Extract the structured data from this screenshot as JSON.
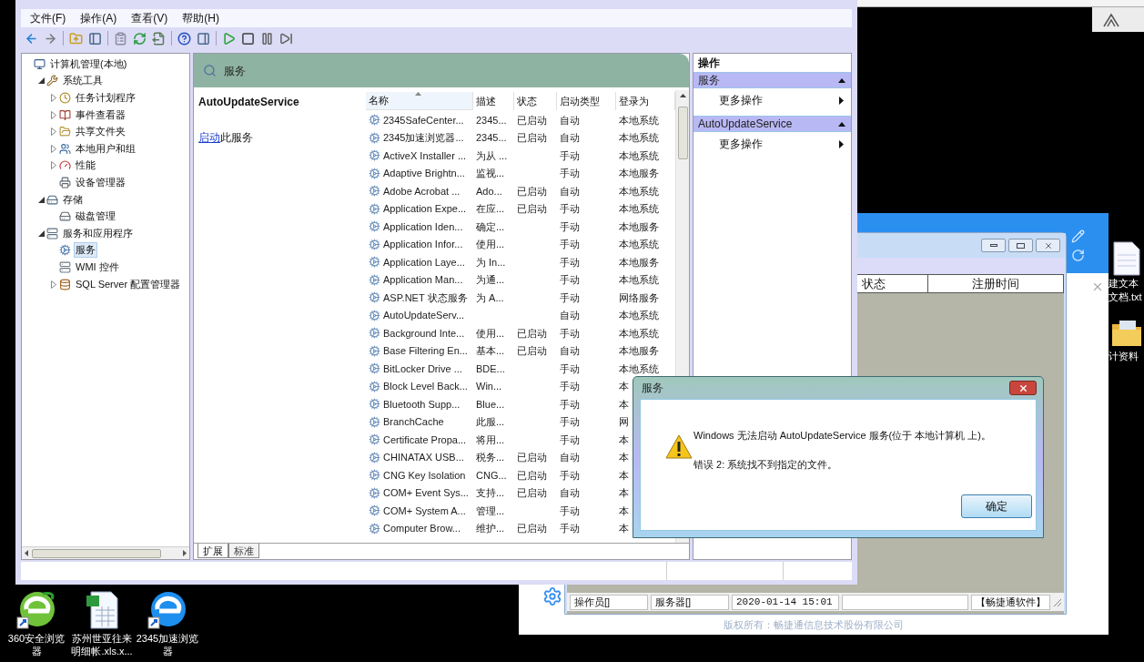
{
  "main_window": {
    "menu": [
      "文件(F)",
      "操作(A)",
      "查看(V)",
      "帮助(H)"
    ],
    "tree": [
      {
        "label": "计算机管理(本地)",
        "selected": false,
        "children": [
          {
            "label": "系统工具",
            "expanded": true,
            "selected": false,
            "children": [
              {
                "label": "任务计划程序",
                "expanded": false,
                "selected": false
              },
              {
                "label": "事件查看器",
                "expanded": false,
                "selected": false
              },
              {
                "label": "共享文件夹",
                "expanded": false,
                "selected": false
              },
              {
                "label": "本地用户和组",
                "expanded": false,
                "selected": false
              },
              {
                "label": "性能",
                "expanded": false,
                "selected": false
              },
              {
                "label": "设备管理器",
                "selected": false
              }
            ]
          },
          {
            "label": "存储",
            "expanded": true,
            "selected": false,
            "children": [
              {
                "label": "磁盘管理",
                "selected": false
              }
            ]
          },
          {
            "label": "服务和应用程序",
            "expanded": true,
            "selected": false,
            "children": [
              {
                "label": "服务",
                "selected": true
              },
              {
                "label": "WMI 控件",
                "selected": false
              },
              {
                "label": "SQL Server 配置管理器",
                "expanded": false,
                "selected": false
              }
            ]
          }
        ]
      }
    ],
    "section_header": "服务",
    "detail": {
      "title": "AutoUpdateService",
      "link": "启动",
      "text": "此服务"
    },
    "columns": [
      {
        "label": "名称",
        "sorted": true
      },
      {
        "label": "描述",
        "sorted": false
      },
      {
        "label": "状态",
        "sorted": false
      },
      {
        "label": "启动类型",
        "sorted": false
      },
      {
        "label": "登录为",
        "sorted": false
      }
    ],
    "rows": [
      {
        "name": "2345SafeCenter...",
        "description": "2345...",
        "status": "已启动",
        "startup": "自动",
        "logon": "本地系统"
      },
      {
        "name": "2345加速浏览器...",
        "description": "2345...",
        "status": "已启动",
        "startup": "自动",
        "logon": "本地系统"
      },
      {
        "name": "ActiveX Installer ...",
        "description": "为从 ...",
        "startup": "手动",
        "logon": "本地系统"
      },
      {
        "name": "Adaptive Brightn...",
        "description": "监视...",
        "startup": "手动",
        "logon": "本地服务"
      },
      {
        "name": "Adobe Acrobat ...",
        "description": "Ado...",
        "status": "已启动",
        "startup": "自动",
        "logon": "本地系统"
      },
      {
        "name": "Application Expe...",
        "description": "在应...",
        "status": "已启动",
        "startup": "手动",
        "logon": "本地系统"
      },
      {
        "name": "Application Iden...",
        "description": "确定...",
        "startup": "手动",
        "logon": "本地服务"
      },
      {
        "name": "Application Infor...",
        "description": "使用...",
        "startup": "手动",
        "logon": "本地系统"
      },
      {
        "name": "Application Laye...",
        "description": "为 In...",
        "startup": "手动",
        "logon": "本地服务"
      },
      {
        "name": "Application Man...",
        "description": "为通...",
        "startup": "手动",
        "logon": "本地系统"
      },
      {
        "name": "ASP.NET 状态服务",
        "description": "为 A...",
        "startup": "手动",
        "logon": "网络服务"
      },
      {
        "name": "AutoUpdateServ...",
        "startup": "自动",
        "logon": "本地系统"
      },
      {
        "name": "Background Inte...",
        "description": "使用...",
        "status": "已启动",
        "startup": "手动",
        "logon": "本地系统"
      },
      {
        "name": "Base Filtering En...",
        "description": "基本...",
        "status": "已启动",
        "startup": "自动",
        "logon": "本地服务"
      },
      {
        "name": "BitLocker Drive ...",
        "description": "BDE...",
        "startup": "手动",
        "logon": "本地系统"
      },
      {
        "name": "Block Level Back...",
        "description": "Win...",
        "startup": "手动",
        "logon": "本"
      },
      {
        "name": "Bluetooth Supp...",
        "description": "Blue...",
        "startup": "手动",
        "logon": "本"
      },
      {
        "name": "BranchCache",
        "description": "此服...",
        "startup": "手动",
        "logon": "网"
      },
      {
        "name": "Certificate Propa...",
        "description": "将用...",
        "startup": "手动",
        "logon": "本"
      },
      {
        "name": "CHINATAX USB...",
        "description": "税务...",
        "status": "已启动",
        "startup": "自动",
        "logon": "本"
      },
      {
        "name": "CNG Key Isolation",
        "description": "CNG...",
        "status": "已启动",
        "startup": "手动",
        "logon": "本"
      },
      {
        "name": "COM+ Event Sys...",
        "description": "支持...",
        "status": "已启动",
        "startup": "自动",
        "logon": "本"
      },
      {
        "name": "COM+ System A...",
        "description": "管理...",
        "startup": "手动",
        "logon": "本"
      },
      {
        "name": "Computer Brow...",
        "description": "维护...",
        "status": "已启动",
        "startup": "手动",
        "logon": "本"
      }
    ],
    "bottom_tabs": [
      {
        "label": "扩展",
        "selected": true
      },
      {
        "label": "标准",
        "selected": false
      }
    ],
    "actions": {
      "title": "操作",
      "groups": [
        {
          "label": "服务",
          "items": [
            "更多操作"
          ]
        },
        {
          "label": "AutoUpdateService",
          "items": [
            "更多操作"
          ]
        }
      ]
    }
  },
  "background_window": {
    "columns": [
      "状态",
      "注册时间"
    ],
    "status_bar": [
      "操作员[]",
      "服务器[]",
      "2020-01-14 15:01",
      "【畅捷通软件】"
    ],
    "copyright": "版权所有：畅捷通信息技术股份有限公司"
  },
  "dialog": {
    "title": "服务",
    "message": "Windows 无法启动 AutoUpdateService 服务(位于 本地计算机 上)。",
    "error": "错误 2: 系统找不到指定的文件。",
    "button": "确定"
  },
  "desktop_icons": [
    {
      "label": "360安全浏览器",
      "kind": "green-browser"
    },
    {
      "label": "苏州世亚往来明细帐.xls.x...",
      "kind": "spreadsheet"
    },
    {
      "label": "2345加速浏览器",
      "kind": "blue-browser"
    }
  ],
  "desktop_icons_right": [
    {
      "label": "建文本文档.txt",
      "kind": "text-file"
    },
    {
      "label": "计资料",
      "kind": "folder"
    }
  ]
}
